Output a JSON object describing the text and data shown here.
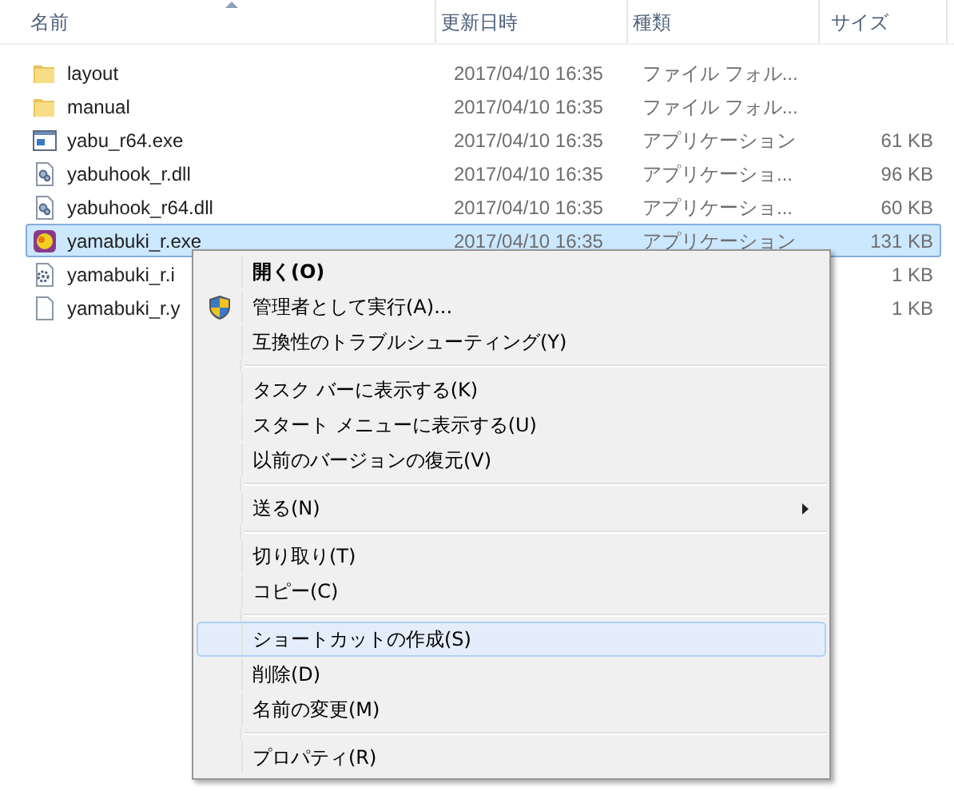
{
  "columns": [
    {
      "label": "名前",
      "sorted": true
    },
    {
      "label": "更新日時",
      "sorted": false
    },
    {
      "label": "種類",
      "sorted": false
    },
    {
      "label": "サイズ",
      "sorted": false
    }
  ],
  "files": [
    {
      "name": "layout",
      "kind": "folder",
      "date": "2017/04/10 16:35",
      "type": "ファイル フォル...",
      "selected": false
    },
    {
      "name": "manual",
      "kind": "folder",
      "date": "2017/04/10 16:35",
      "type": "ファイル フォル...",
      "selected": false
    },
    {
      "name": "yabu_r64.exe",
      "kind": "window",
      "date": "2017/04/10 16:35",
      "type": "アプリケーション",
      "size": "61 KB",
      "selected": false
    },
    {
      "name": "yabuhook_r.dll",
      "kind": "dll",
      "date": "2017/04/10 16:35",
      "type": "アプリケーショ...",
      "size": "96 KB",
      "selected": false
    },
    {
      "name": "yabuhook_r64.dll",
      "kind": "dll",
      "date": "2017/04/10 16:35",
      "type": "アプリケーショ...",
      "size": "60 KB",
      "selected": false
    },
    {
      "name": "yamabuki_r.exe",
      "kind": "app",
      "date": "2017/04/10 16:35",
      "type": "アプリケーション",
      "size": "131 KB",
      "selected": true
    },
    {
      "name": "yamabuki_r.i",
      "kind": "settings",
      "size": "1 KB",
      "selected": false
    },
    {
      "name": "yamabuki_r.y",
      "kind": "doc",
      "size": "1 KB",
      "selected": false
    }
  ],
  "context_menu": [
    {
      "kind": "item",
      "label": "開く(O)",
      "default": true,
      "shield": false,
      "submenu": false,
      "selected": false
    },
    {
      "kind": "item",
      "label": "管理者として実行(A)...",
      "default": false,
      "shield": true,
      "submenu": false,
      "selected": false
    },
    {
      "kind": "item",
      "label": "互換性のトラブルシューティング(Y)",
      "default": false,
      "shield": false,
      "submenu": false,
      "selected": false
    },
    {
      "kind": "separator"
    },
    {
      "kind": "item",
      "label": "タスク バーに表示する(K)",
      "default": false,
      "shield": false,
      "submenu": false,
      "selected": false
    },
    {
      "kind": "item",
      "label": "スタート メニューに表示する(U)",
      "default": false,
      "shield": false,
      "submenu": false,
      "selected": false
    },
    {
      "kind": "item",
      "label": "以前のバージョンの復元(V)",
      "default": false,
      "shield": false,
      "submenu": false,
      "selected": false
    },
    {
      "kind": "separator"
    },
    {
      "kind": "item",
      "label": "送る(N)",
      "default": false,
      "shield": false,
      "submenu": true,
      "selected": false
    },
    {
      "kind": "separator"
    },
    {
      "kind": "item",
      "label": "切り取り(T)",
      "default": false,
      "shield": false,
      "submenu": false,
      "selected": false
    },
    {
      "kind": "item",
      "label": "コピー(C)",
      "default": false,
      "shield": false,
      "submenu": false,
      "selected": false
    },
    {
      "kind": "separator"
    },
    {
      "kind": "item",
      "label": "ショートカットの作成(S)",
      "default": false,
      "shield": false,
      "submenu": false,
      "selected": true
    },
    {
      "kind": "item",
      "label": "削除(D)",
      "default": false,
      "shield": false,
      "submenu": false,
      "selected": false
    },
    {
      "kind": "item",
      "label": "名前の変更(M)",
      "default": false,
      "shield": false,
      "submenu": false,
      "selected": false
    },
    {
      "kind": "separator"
    },
    {
      "kind": "item",
      "label": "プロパティ(R)",
      "default": false,
      "shield": false,
      "submenu": false,
      "selected": false
    }
  ]
}
